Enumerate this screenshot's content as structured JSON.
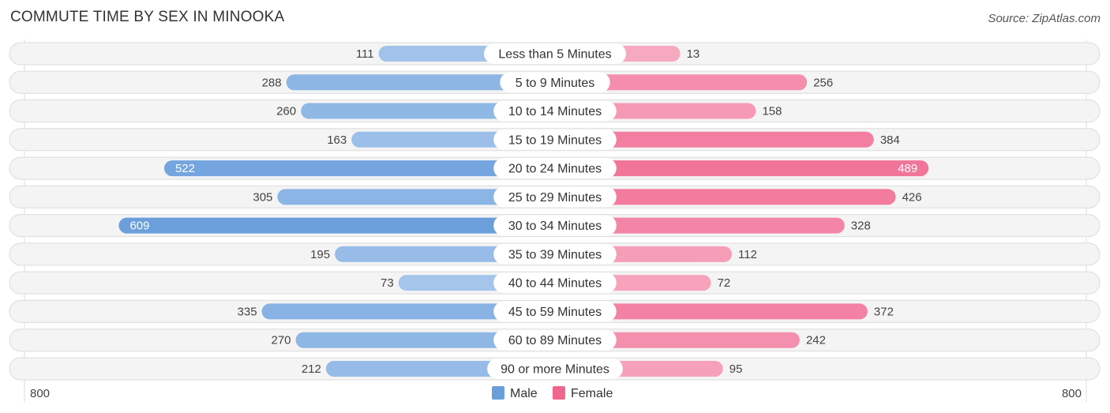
{
  "chart_data": {
    "type": "bar",
    "orientation": "horizontal-diverging",
    "title": "COMMUTE TIME BY SEX IN MINOOKA",
    "source": "Source: ZipAtlas.com",
    "categories": [
      "Less than 5 Minutes",
      "5 to 9 Minutes",
      "10 to 14 Minutes",
      "15 to 19 Minutes",
      "20 to 24 Minutes",
      "25 to 29 Minutes",
      "30 to 34 Minutes",
      "35 to 39 Minutes",
      "40 to 44 Minutes",
      "45 to 59 Minutes",
      "60 to 89 Minutes",
      "90 or more Minutes"
    ],
    "series": [
      {
        "name": "Male",
        "color": "#6a9fdc",
        "side": "left",
        "values": [
          111,
          288,
          260,
          163,
          522,
          305,
          609,
          195,
          73,
          335,
          270,
          212
        ]
      },
      {
        "name": "Female",
        "color": "#f0668f",
        "side": "right",
        "values": [
          13,
          256,
          158,
          384,
          489,
          426,
          328,
          112,
          72,
          372,
          242,
          95
        ]
      }
    ],
    "axis": {
      "left_label": "800",
      "right_label": "800",
      "max": 800
    },
    "legend": {
      "position": "bottom-center",
      "items": [
        "Male",
        "Female"
      ]
    }
  }
}
